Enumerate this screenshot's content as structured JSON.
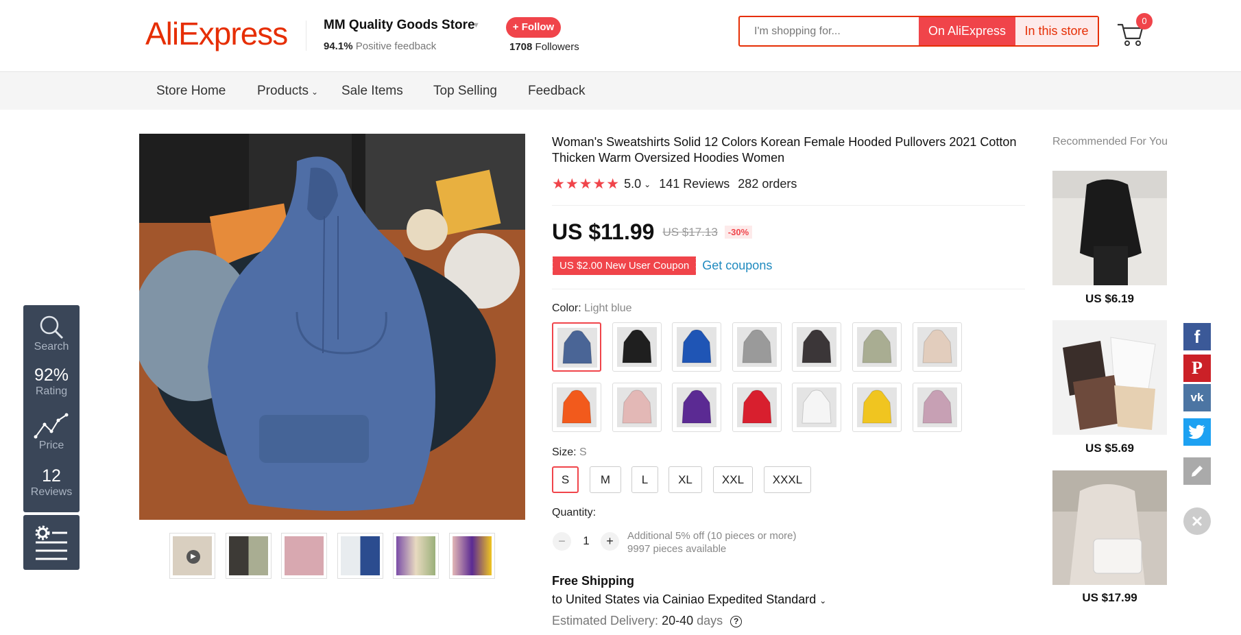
{
  "header": {
    "logo": "AliExpress",
    "store_name": "MM Quality Goods Store",
    "feedback_pct": "94.1%",
    "feedback_label": "Positive feedback",
    "follow_label": "+ Follow",
    "followers_count": "1708",
    "followers_label": "Followers",
    "search_placeholder": "I'm shopping for...",
    "search_ali_label": "On AliExpress",
    "search_store_label": "In this store",
    "cart_count": "0"
  },
  "nav": {
    "items": [
      {
        "label": "Store Home"
      },
      {
        "label": "Products"
      },
      {
        "label": "Sale Items"
      },
      {
        "label": "Top Selling"
      },
      {
        "label": "Feedback"
      }
    ]
  },
  "side_widget": {
    "search_label": "Search",
    "rating_value": "92%",
    "rating_label": "Rating",
    "price_label": "Price",
    "reviews_value": "12",
    "reviews_label": "Reviews"
  },
  "product": {
    "title": "Woman's Sweatshirts Solid 12 Colors Korean Female Hooded Pullovers 2021 Cotton Thicken Warm Oversized Hoodies Women",
    "rating": "5.0",
    "reviews": "141 Reviews",
    "orders": "282 orders",
    "price": "US $11.99",
    "orig_price": "US $17.13",
    "discount": "-30%",
    "coupon": "US $2.00 New User Coupon",
    "get_coupons": "Get coupons",
    "color_label": "Color:",
    "color_value": "Light blue",
    "size_label": "Size:",
    "size_value": "S",
    "sizes": [
      "S",
      "M",
      "L",
      "XL",
      "XXL",
      "XXXL"
    ],
    "quantity_label": "Quantity:",
    "quantity": "1",
    "qty_note_1": "Additional 5% off (10 pieces or more)",
    "qty_note_2": "9997 pieces available",
    "shipping_title": "Free Shipping",
    "shipping_desc": "to United States via Cainiao Expedited Standard",
    "delivery_label": "Estimated Delivery:",
    "delivery_value": "20-40",
    "delivery_unit": "days"
  },
  "swatch_colors": [
    "#4a6596",
    "#1f1f1f",
    "#1f55b5",
    "#9a9a9a",
    "#3b3638",
    "#a9ad92",
    "#e2cdbd",
    "#f25a1c",
    "#e3b8b6",
    "#5b2a93",
    "#d81f2e",
    "#f5f5f5",
    "#f0c520",
    "#c7a0b4"
  ],
  "thumb_colors": [
    "#d9cfc0",
    "#3d3a36",
    "#d8a8b0",
    "#e8ecef",
    "#7b4ea8",
    "#c0a060"
  ],
  "recommended": {
    "title": "Recommended For You",
    "items": [
      {
        "price": "US $6.19"
      },
      {
        "price": "US $5.69"
      },
      {
        "price": "US $17.99"
      }
    ]
  },
  "share_icons": [
    "facebook-icon",
    "pinterest-icon",
    "vk-icon",
    "twitter-icon",
    "edit-icon",
    "close-icon"
  ]
}
